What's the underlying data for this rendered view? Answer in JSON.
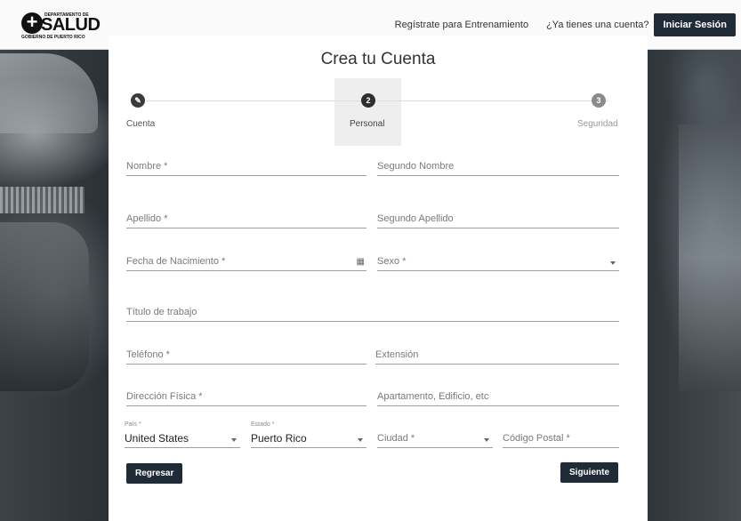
{
  "header": {
    "logo": {
      "dept": "DEPARTAMENTO DE",
      "word": "SALUD",
      "sub": "GOBIERNO DE PUERTO RICO"
    },
    "register_link": "Regístrate para Entrenamiento",
    "have_account_link": "¿Ya tienes una cuenta?",
    "login_button": "Iniciar Sesión"
  },
  "form": {
    "title": "Crea tu Cuenta",
    "steps": [
      {
        "number": "✎",
        "label": "Cuenta",
        "state": "completed"
      },
      {
        "number": "2",
        "label": "Personal",
        "state": "active"
      },
      {
        "number": "3",
        "label": "Seguridad",
        "state": "pending"
      }
    ],
    "fields": {
      "nombre": "Nombre *",
      "segundo_nombre": "Segundo Nombre",
      "apellido": "Apellido *",
      "segundo_apellido": "Segundo Apellido",
      "fecha_nacimiento": "Fecha de Nacimiento *",
      "sexo": "Sexo *",
      "titulo": "Título de trabajo",
      "telefono": "Teléfono *",
      "extension": "Extensión",
      "direccion": "Dirección Física *",
      "apartamento": "Apartamento, Edificio, etc",
      "pais_label": "País *",
      "pais_value": "United States",
      "estado_label": "Estado *",
      "estado_value": "Puerto Rico",
      "ciudad": "Ciudad *",
      "codigo_postal": "Código Postal *"
    },
    "back_button": "Regresar",
    "next_button": "Siguiente"
  },
  "colors": {
    "primary_button": "#1f2b36",
    "step_active": "#3a3a3a",
    "step_pending": "#8a8a8a"
  }
}
